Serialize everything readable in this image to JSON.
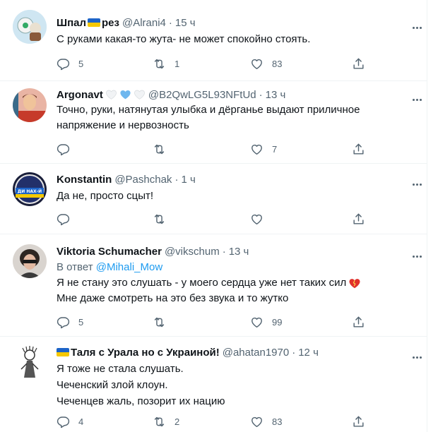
{
  "tweets": [
    {
      "name": "Шпал",
      "name_suffix": "рез",
      "handle": "@Alrani4",
      "separator": "·",
      "time": "15 ч",
      "lines": [
        "С руками какая-то жута- не может спокойно стоять."
      ],
      "replies": "5",
      "retweets": "1",
      "likes": "83"
    },
    {
      "name": "Argonavt",
      "handle": "@B2QwLG5L93NFtUd",
      "separator": "·",
      "time": "13 ч",
      "lines": [
        "Точно, руки, натянутая улыбка и дёрганье выдают приличное",
        "напряжение и нервозность"
      ],
      "replies": "",
      "retweets": "",
      "likes": "7"
    },
    {
      "name": "Konstantin",
      "handle": "@Pashchak",
      "separator": "·",
      "time": "1 ч",
      "avatar_text": "ДИ НАХ-Й",
      "lines": [
        "Да не, просто сцыт!"
      ],
      "replies": "",
      "retweets": "",
      "likes": ""
    },
    {
      "name": "Viktoria Schumacher",
      "handle": "@vikschum",
      "separator": "·",
      "time": "13 ч",
      "reply_prefix": "В ответ",
      "reply_handle": "@Mihali_Mow",
      "lines": [
        "Я не стану это слушать - у моего  сердца уже нет таких сил",
        "Мне даже смотреть на это без звука и то жутко"
      ],
      "replies": "5",
      "retweets": "",
      "likes": "99"
    },
    {
      "name": "Таля с Урала но с Украиной!",
      "handle": "@ahatan1970",
      "separator": "·",
      "time": "12 ч",
      "lines": [
        "Я тоже не стала слушать.",
        "Чеченский злой клоун.",
        "Чеченцев жаль, позорит их нацию"
      ],
      "replies": "4",
      "retweets": "2",
      "likes": "83"
    }
  ],
  "icons": {
    "reply": "reply-icon",
    "retweet": "retweet-icon",
    "like": "heart-icon",
    "share": "share-icon",
    "more": "more-icon"
  },
  "colors": {
    "text": "#0f1419",
    "muted": "#536471",
    "link": "#1d9bf0",
    "divider": "#eff3f4"
  }
}
